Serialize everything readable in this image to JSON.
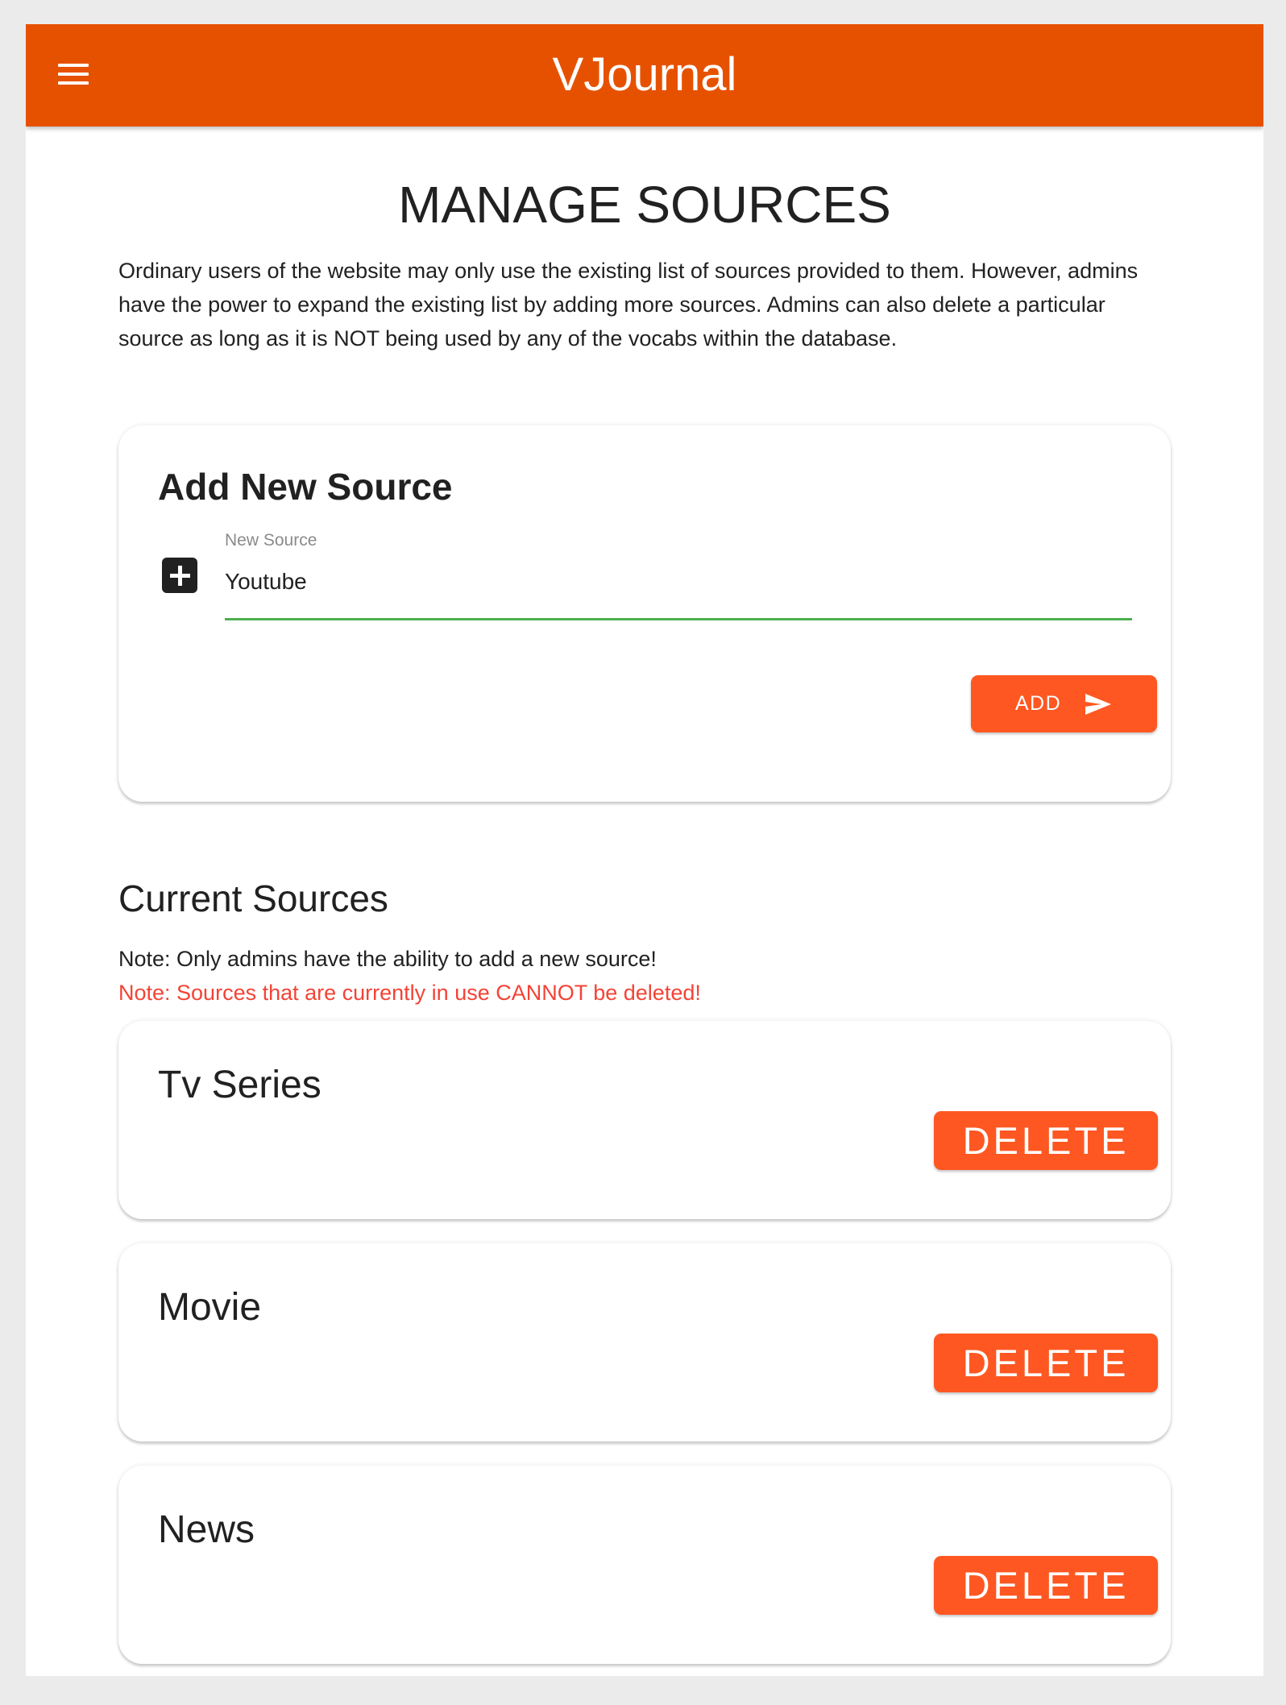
{
  "appbar": {
    "title": "VJournal",
    "menu_icon": "menu-icon"
  },
  "page": {
    "title": "MANAGE SOURCES",
    "intro": "Ordinary users of the website may only use the existing list of sources provided to them. However, admins have the power to expand the existing list by adding more sources. Admins can also delete a particular source as long as it is NOT being used by any of the vocabs within the database."
  },
  "add_source": {
    "heading": "Add New Source",
    "field_label": "New Source",
    "field_value": "Youtube",
    "add_label": "ADD",
    "add_icon": "send-icon",
    "field_icon": "plus-box-icon"
  },
  "current_sources": {
    "heading": "Current Sources",
    "note_admin": "Note: Only admins have the ability to add a new source!",
    "note_warning": "Note: Sources that are currently in use CANNOT be deleted!",
    "items": [
      {
        "name": "Tv Series",
        "delete_label": "DELETE"
      },
      {
        "name": "Movie",
        "delete_label": "DELETE"
      },
      {
        "name": "News",
        "delete_label": "DELETE"
      }
    ]
  },
  "colors": {
    "appbar": "#e65100",
    "button": "#ff5722",
    "input_underline": "#4caf50",
    "warning_text": "#f44336"
  }
}
